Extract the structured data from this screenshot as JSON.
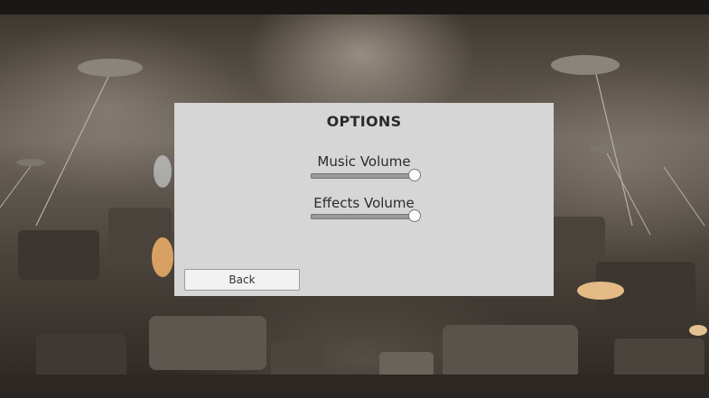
{
  "background": {
    "description_icon": "war-scene-background"
  },
  "options": {
    "title": "OPTIONS",
    "music": {
      "label": "Music Volume",
      "value": 1.0
    },
    "effects": {
      "label": "Effects Volume",
      "value": 1.0
    },
    "back_label": "Back"
  },
  "colors": {
    "panel": "#d6d6d6",
    "title_text": "#2a2a2a",
    "button_bg": "#f2f2f2",
    "button_border": "#9c9c9c"
  }
}
